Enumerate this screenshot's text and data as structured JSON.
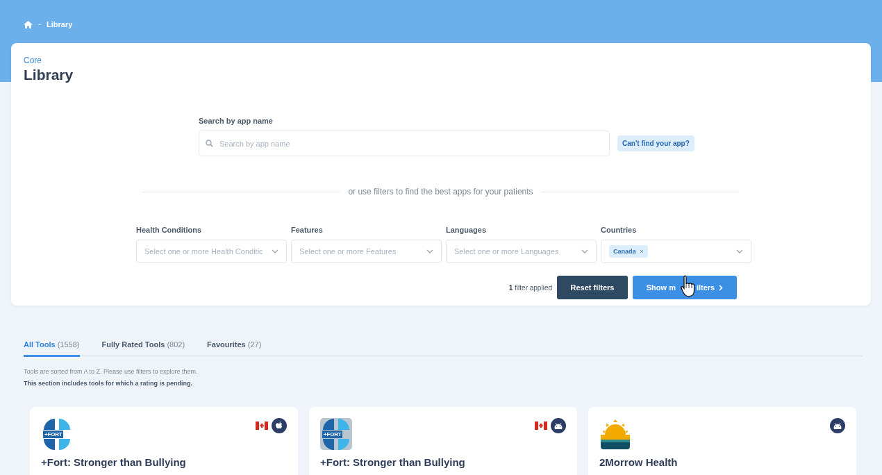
{
  "breadcrumb": {
    "current": "Library"
  },
  "header": {
    "eyebrow": "Core",
    "title": "Library"
  },
  "search": {
    "label": "Search by app name",
    "placeholder": "Search by app name",
    "help_link": "Can't find your app?"
  },
  "divider_text": "or use filters to find the best apps for your patients",
  "filters": [
    {
      "label": "Health Conditions",
      "placeholder": "Select one or more Health Conditic"
    },
    {
      "label": "Features",
      "placeholder": "Select one or more Features"
    },
    {
      "label": "Languages",
      "placeholder": "Select one or more Languages"
    },
    {
      "label": "Countries",
      "chips": [
        "Canada"
      ]
    }
  ],
  "filter_count": {
    "number": "1",
    "text": "filter applied"
  },
  "buttons": [
    {
      "kind": "reset",
      "label_parts": [
        "Reset filters"
      ]
    },
    {
      "kind": "more",
      "label_parts": [
        "Show m",
        "ilters"
      ]
    }
  ],
  "tabs": [
    {
      "label": "All Tools",
      "count": "(1558)",
      "selected": true
    },
    {
      "label": "Fully Rated Tools",
      "count": "(802)",
      "selected": false
    },
    {
      "label": "Favourites",
      "count": "(27)",
      "selected": false
    }
  ],
  "notes": [
    {
      "kind": "plain",
      "text": "Tools are sorted from A to Z. Please use filters to explore them."
    },
    {
      "kind": "bold",
      "text": "This section includes tools for which a rating is pending."
    }
  ],
  "apps": [
    {
      "title": "+Fort: Stronger than Bullying",
      "logo": {
        "kind": "fort",
        "text": "+FORT"
      },
      "badges": [
        {
          "kind": "flag"
        },
        {
          "kind": "apple"
        }
      ]
    },
    {
      "title": "+Fort: Stronger than Bullying",
      "logo": {
        "kind": "fort-tile",
        "text": "+FORT"
      },
      "badges": [
        {
          "kind": "flag"
        },
        {
          "kind": "android"
        }
      ]
    },
    {
      "title": "2Morrow Health",
      "logo": {
        "kind": "sunrise"
      },
      "badges": [
        {
          "kind": "android"
        }
      ]
    }
  ]
}
